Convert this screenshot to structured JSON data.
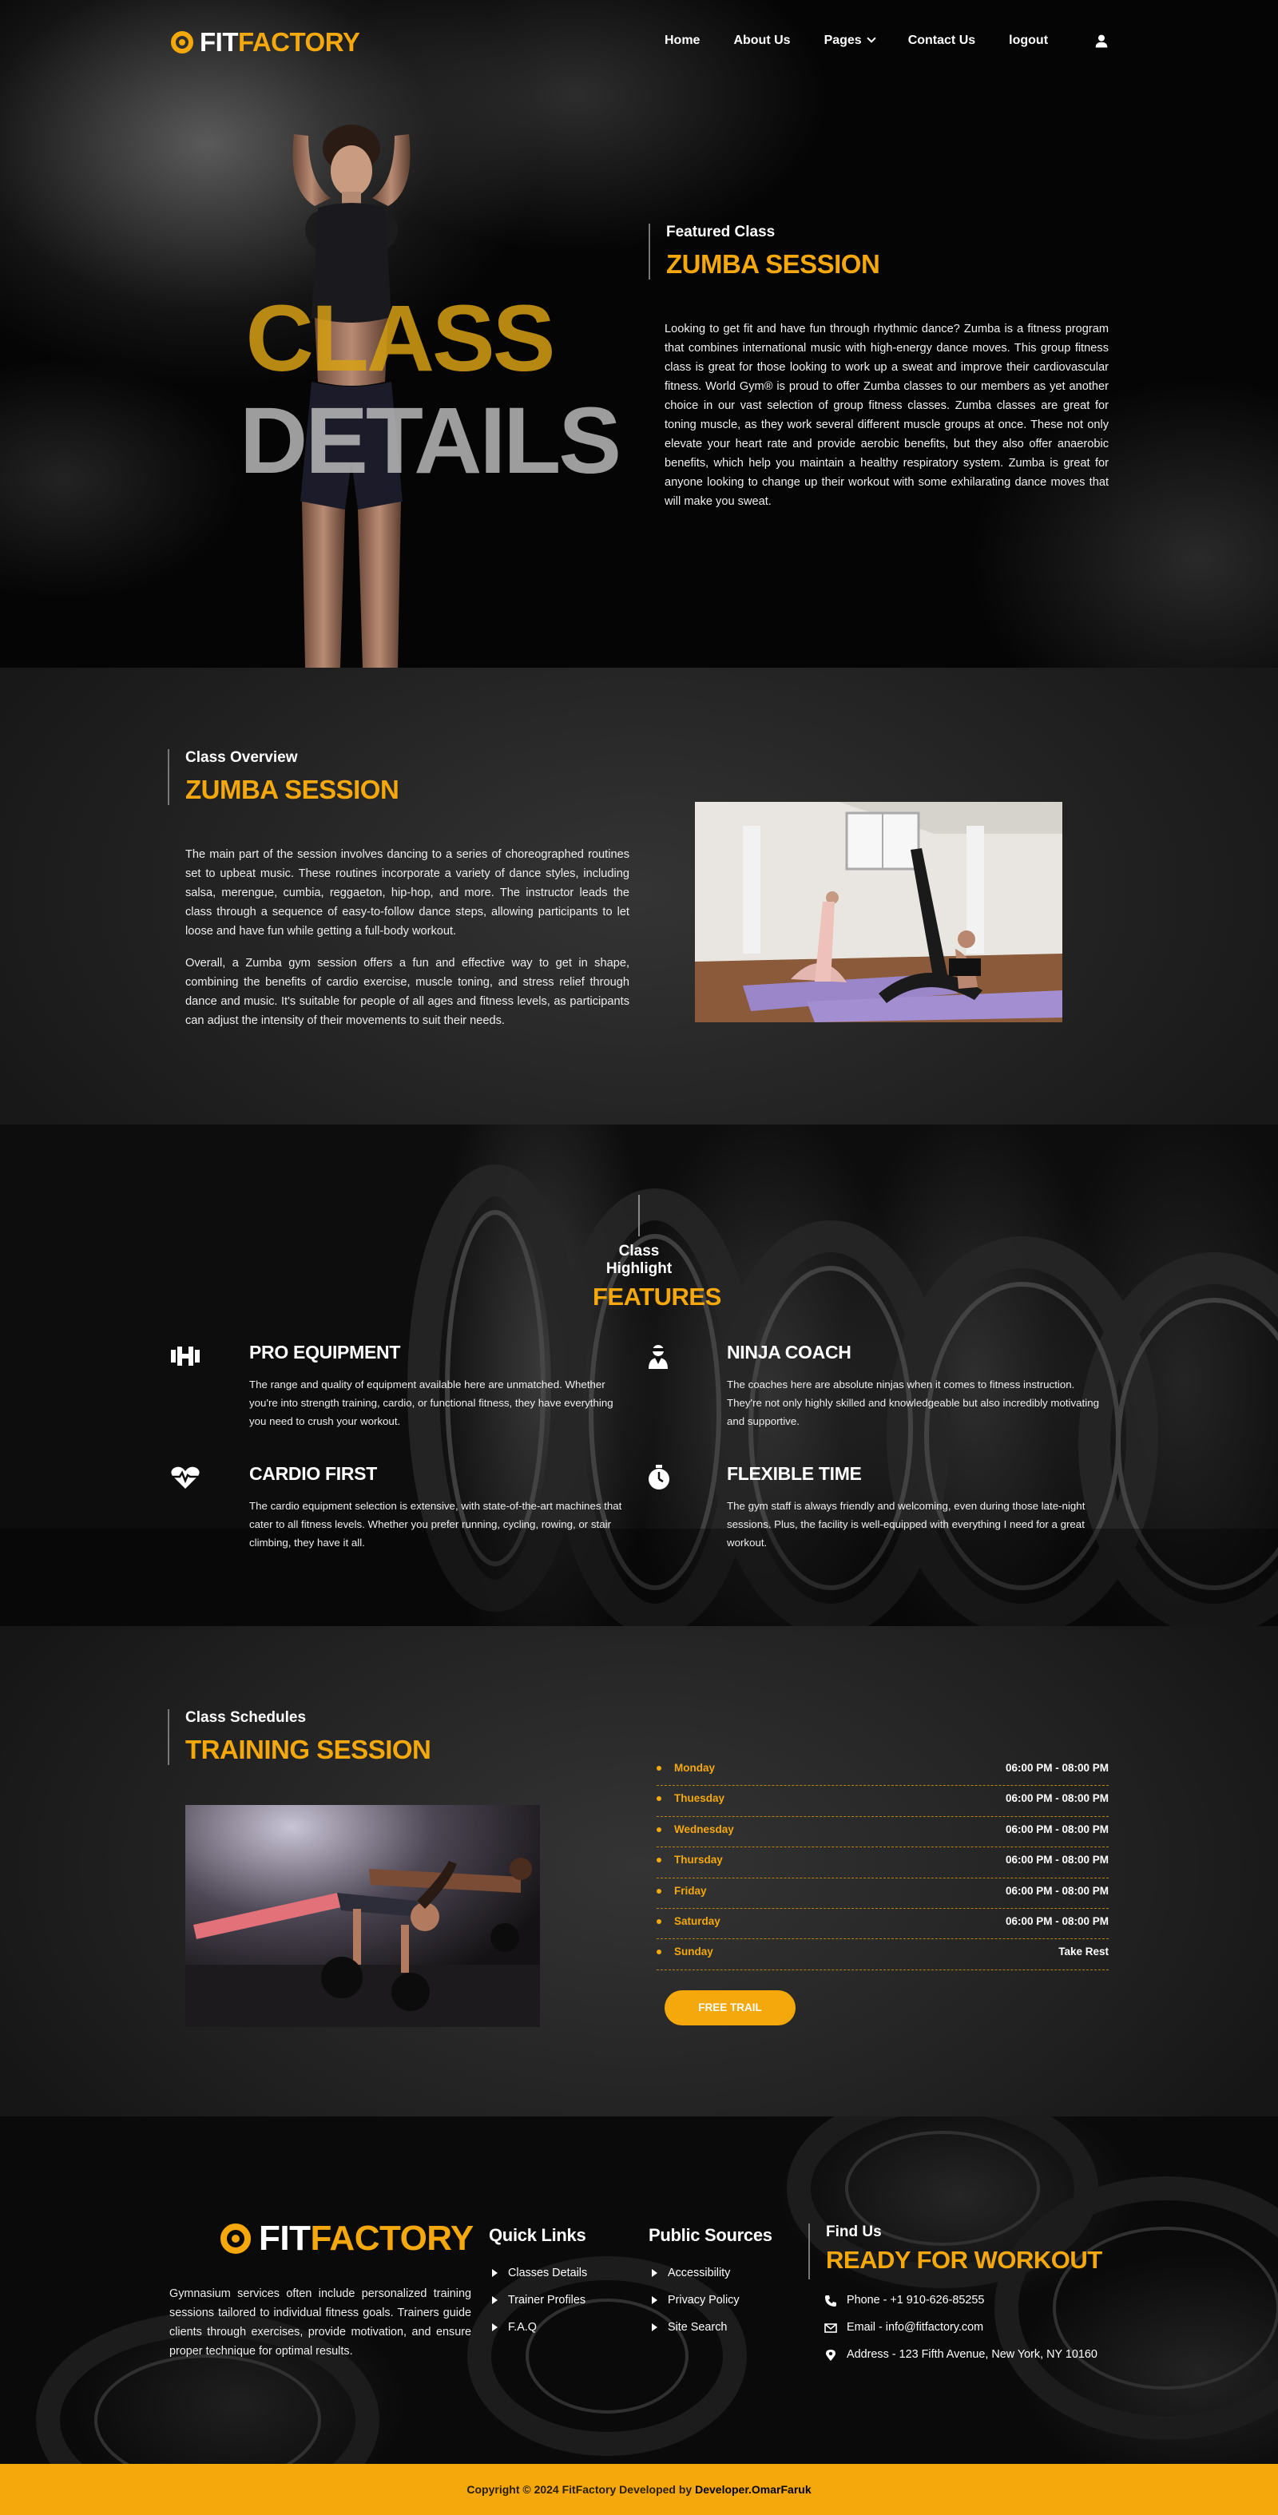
{
  "brand": {
    "logo_part1": "FIT",
    "logo_part2": "FACTORY",
    "accent_color": "#f4a80c"
  },
  "nav": {
    "items": [
      "Home",
      "About Us",
      "Pages",
      "Contact Us",
      "logout"
    ],
    "user_icon": "user-icon"
  },
  "hero": {
    "title_line1": "CLASS",
    "title_line2": "DETAILS",
    "eyebrow": "Featured Class",
    "heading": "ZUMBA SESSION",
    "text": "Looking to get fit and have fun through rhythmic dance? Zumba is a fitness program that combines international music with high-energy dance moves. This group fitness class is great for those looking to work up a sweat and improve their cardiovascular fitness. World Gym® is proud to offer Zumba classes to our members as yet another choice in our vast selection of group fitness classes. Zumba classes are great for toning muscle, as they work several different muscle groups at once. These not only elevate your heart rate and provide aerobic benefits, but they also offer anaerobic benefits, which help you maintain a healthy respiratory system. Zumba is great for anyone looking to change up their workout with some exhilarating dance moves that will make you sweat."
  },
  "overview": {
    "eyebrow": "Class Overview",
    "heading": "ZUMBA SESSION",
    "paragraph1": "The main part of the session involves dancing to a series of choreographed routines set to upbeat music. These routines incorporate a variety of dance styles, including salsa, merengue, cumbia, reggaeton, hip-hop, and more. The instructor leads the class through a sequence of easy-to-follow dance steps, allowing participants to let loose and have fun while getting a full-body workout.",
    "paragraph2": "Overall, a Zumba gym session offers a fun and effective way to get in shape, combining the benefits of cardio exercise, muscle toning, and stress relief through dance and music. It's suitable for people of all ages and fitness levels, as participants can adjust the intensity of their movements to suit their needs."
  },
  "features": {
    "eyebrow": "Class Highlight",
    "heading": "FEATURES",
    "items": [
      {
        "icon": "dumbbell-icon",
        "title": "PRO EQUIPMENT",
        "text": "The range and quality of equipment available here are unmatched. Whether you're into strength training, cardio, or functional fitness, they have everything you need to crush your workout."
      },
      {
        "icon": "coach-icon",
        "title": "NINJA COACH",
        "text": "The coaches here are absolute ninjas when it comes to fitness instruction. They're not only highly skilled and knowledgeable but also incredibly motivating and supportive."
      },
      {
        "icon": "heartbeat-icon",
        "title": "CARDIO FIRST",
        "text": "The cardio equipment selection is extensive, with state-of-the-art machines that cater to all fitness levels. Whether you prefer running, cycling, rowing, or stair climbing, they have it all."
      },
      {
        "icon": "stopwatch-icon",
        "title": "FLEXIBLE TIME",
        "text": "The gym staff is always friendly and welcoming, even during those late-night sessions. Plus, the facility is well-equipped with everything I need for a great workout."
      }
    ]
  },
  "schedule": {
    "eyebrow": "Class Schedules",
    "heading": "TRAINING SESSION",
    "rows": [
      {
        "day": "Monday",
        "time": "06:00 PM - 08:00 PM"
      },
      {
        "day": "Thuesday",
        "time": "06:00 PM - 08:00 PM"
      },
      {
        "day": "Wednesday",
        "time": "06:00 PM - 08:00 PM"
      },
      {
        "day": "Thursday",
        "time": "06:00 PM - 08:00 PM"
      },
      {
        "day": "Friday",
        "time": "06:00 PM - 08:00 PM"
      },
      {
        "day": "Saturday",
        "time": "06:00 PM - 08:00 PM"
      },
      {
        "day": "Sunday",
        "time": "Take Rest"
      }
    ],
    "button": "FREE TRAIL"
  },
  "footer": {
    "about": "Gymnasium services often include personalized training sessions tailored to individual fitness goals. Trainers guide clients through exercises, provide motivation, and ensure proper technique for optimal results.",
    "quick_links": {
      "title": "Quick Links",
      "items": [
        "Classes Details",
        "Trainer Profiles",
        "F.A.Q"
      ]
    },
    "public_sources": {
      "title": "Public Sources",
      "items": [
        "Accessibility",
        "Privacy Policy",
        "Site Search"
      ]
    },
    "find": {
      "eyebrow": "Find Us",
      "heading": "READY FOR WORKOUT",
      "phone": "Phone - +1 910-626-85255",
      "email": "Email - info@fitfactory.com",
      "address": "Address - 123 Fifth Avenue, New York, NY 10160"
    },
    "copyright": "Copyright © 2024 FitFactory Developed by ",
    "developer": "Developer.OmarFaruk"
  }
}
